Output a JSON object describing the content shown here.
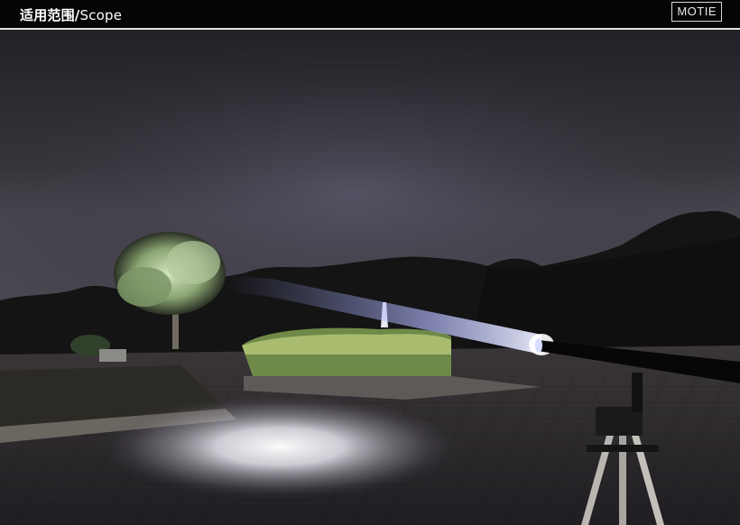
{
  "header": {
    "title_cn": "适用范围/",
    "title_en": "Scope",
    "brand": "MOTIE"
  },
  "scene": {
    "sky_color": "#3b3a40",
    "beam_color": "#c8ccff",
    "ground_light_color": "#ffffff"
  }
}
